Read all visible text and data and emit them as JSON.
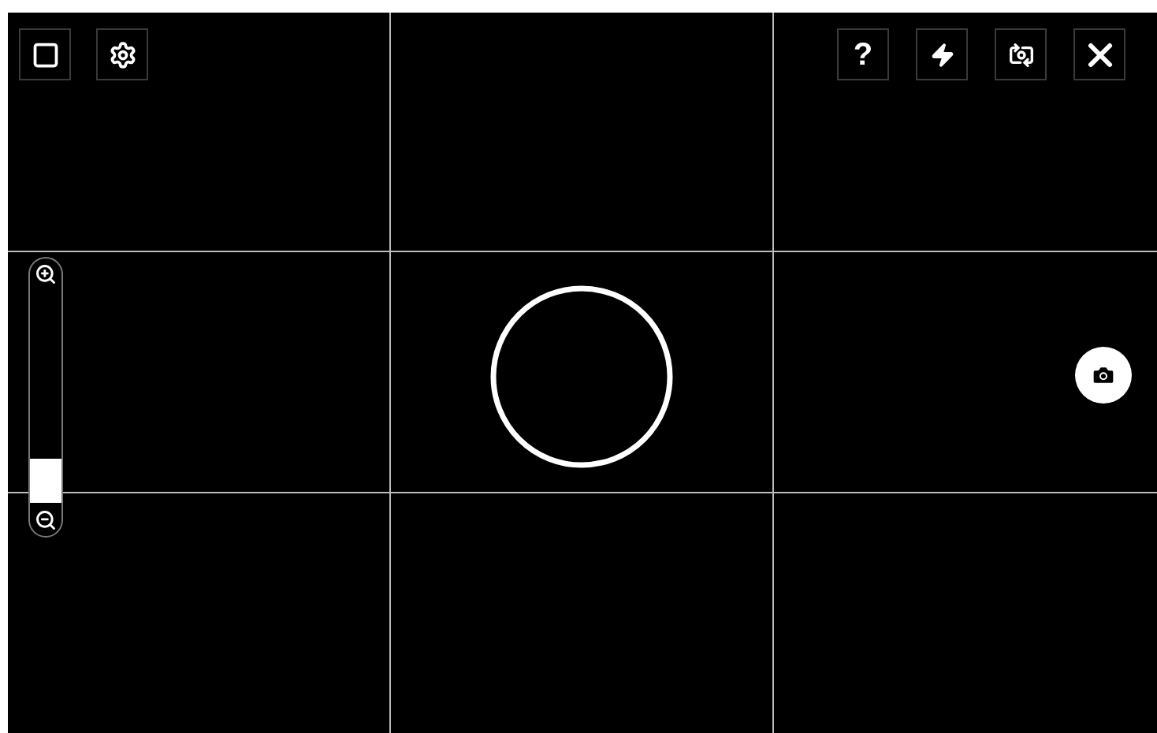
{
  "toolbar_left": [
    {
      "kind": "aspect"
    },
    {
      "kind": "settings"
    }
  ],
  "toolbar_right": [
    {
      "kind": "help",
      "label": "?"
    },
    {
      "kind": "flash"
    },
    {
      "kind": "switch-camera"
    },
    {
      "kind": "close"
    }
  ]
}
